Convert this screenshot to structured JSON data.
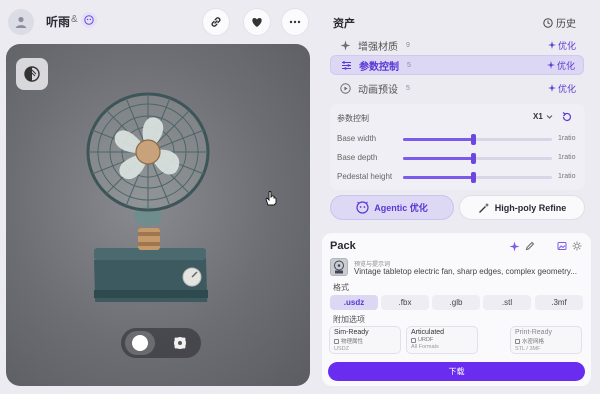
{
  "header": {
    "user_name": "听雨",
    "amp": "&"
  },
  "viewport": {
    "toggle": [
      "solid-mode-icon",
      "texture-mode-icon"
    ]
  },
  "assets": {
    "title": "资产",
    "history_label": "历史",
    "items": [
      {
        "label": "增强材质",
        "count": "9",
        "optimize": "优化"
      },
      {
        "label": "参数控制",
        "count": "5",
        "optimize": "优化"
      },
      {
        "label": "动画预设",
        "count": "5",
        "optimize": "优化"
      }
    ]
  },
  "params": {
    "title": "参数控制",
    "multiplier": "X1",
    "sliders": [
      {
        "label": "Base width",
        "value": "1ratio",
        "level": 0.47
      },
      {
        "label": "Base depth",
        "value": "1ratio",
        "level": 0.47
      },
      {
        "label": "Pedestal height",
        "value": "1ratio",
        "level": 0.47
      }
    ]
  },
  "actions": {
    "agentic": "Agentic 优化",
    "refine": "High-poly Refine"
  },
  "pack": {
    "title": "Pack",
    "prompt_label": "预览与提示词",
    "prompt_text": "Vintage tabletop electric fan, sharp edges, complex geometry...",
    "format_label": "格式",
    "formats": [
      ".usdz",
      ".fbx",
      ".glb",
      ".stl",
      ".3mf"
    ],
    "selected_format": ".usdz",
    "extras_label": "附加选项",
    "extras": [
      {
        "title": "Sim-Ready",
        "check": "物理属性",
        "sub": "USDZ"
      },
      {
        "title": "Articulated",
        "check": "URDF",
        "sub": "All Formats"
      },
      {
        "title": "Print-Ready",
        "check": "水密网格",
        "sub": "STL / 3MF"
      }
    ],
    "download": "下载"
  },
  "colors": {
    "accent": "#6a2df0",
    "accent_soft": "#dcd7f3",
    "background": "#ecebf1"
  }
}
